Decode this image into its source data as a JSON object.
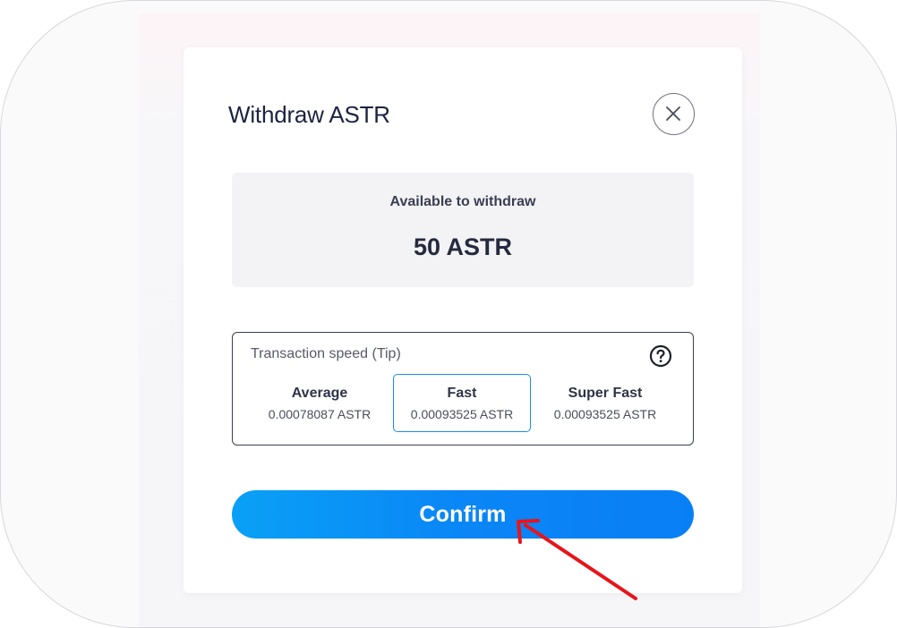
{
  "modal": {
    "title": "Withdraw ASTR",
    "close_icon": "close-icon"
  },
  "balance": {
    "label": "Available to withdraw",
    "value": "50 ASTR"
  },
  "speed": {
    "title": "Transaction speed (Tip)",
    "help_icon": "question-circle-icon",
    "selected": "Fast",
    "options": [
      {
        "name": "Average",
        "fee": "0.00078087 ASTR"
      },
      {
        "name": "Fast",
        "fee": "0.00093525 ASTR"
      },
      {
        "name": "Super Fast",
        "fee": "0.00093525 ASTR"
      }
    ]
  },
  "confirm_label": "Confirm",
  "annotation": {
    "arrow_icon": "red-arrow-icon",
    "arrow_color": "#e8141a"
  },
  "colors": {
    "accent": "#0a86f6",
    "title": "#1c2340",
    "card_bg": "#f3f3f5"
  }
}
